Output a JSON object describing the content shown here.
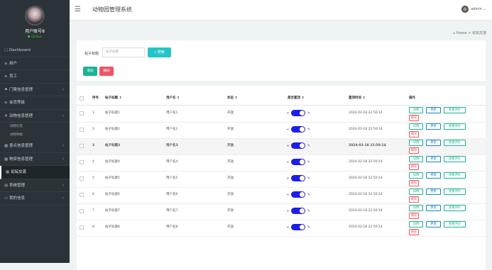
{
  "header": {
    "title": "动物园管理系统",
    "user": "admin"
  },
  "breadcrumb": {
    "home": "Home",
    "sep": ">",
    "current": "论坛交流"
  },
  "sidebar": {
    "username": "用户账号8",
    "status": "Online",
    "items": [
      {
        "label": "Dashboard",
        "icon": "monitor-icon",
        "glyph": "▢",
        "chevron": false
      },
      {
        "label": "用户",
        "icon": "user-icon",
        "glyph": "≡",
        "chevron": false
      },
      {
        "label": "员工",
        "icon": "list-icon",
        "glyph": "≡",
        "chevron": false
      },
      {
        "label": "门票信息管理",
        "icon": "flag-icon",
        "glyph": "⚑",
        "chevron": true
      },
      {
        "label": "会员等级",
        "icon": "list-icon",
        "glyph": "≡",
        "chevron": false
      },
      {
        "label": "动物信息管理",
        "icon": "gear-icon",
        "glyph": "✲",
        "chevron": true
      },
      {
        "label": "景点信息管理",
        "icon": "grid-icon",
        "glyph": "▦",
        "chevron": true
      },
      {
        "label": "物资信息管理",
        "icon": "grid-icon",
        "glyph": "▦",
        "chevron": true
      },
      {
        "label": "论坛交流",
        "icon": "grid-icon",
        "glyph": "▦",
        "chevron": false
      },
      {
        "label": "系统管理",
        "icon": "bars-icon",
        "glyph": "▤",
        "chevron": true
      },
      {
        "label": "我的信息",
        "icon": "card-icon",
        "glyph": "▭",
        "chevron": true
      }
    ],
    "subitems": [
      "动物信息",
      "动物种类"
    ]
  },
  "search": {
    "label": "帖子标题",
    "placeholder": "帖子标题",
    "button": "搜索",
    "add": "增加",
    "delete": "删除"
  },
  "table": {
    "headers": [
      "序号",
      "帖子标题 ⇕",
      "用户名 ⇕",
      "状态 ⇕",
      "是否置顶 ⇕",
      "置顶时间 ⇕",
      "操作"
    ],
    "ops": {
      "detail": "详情",
      "update": "更新",
      "comments": "查看评论",
      "delete": "删除"
    },
    "rows": [
      {
        "no": "1",
        "title": "帖子标题1",
        "user": "用户名1",
        "status": "开放",
        "time": "2024-02-18 22:50:14"
      },
      {
        "no": "2",
        "title": "帖子标题2",
        "user": "用户名2",
        "status": "开放",
        "time": "2024-02-18 22:50:14"
      },
      {
        "no": "3",
        "title": "帖子标题3",
        "user": "用户名3",
        "status": "开放",
        "time": "2024-02-18 22:50:14"
      },
      {
        "no": "4",
        "title": "帖子标题4",
        "user": "用户名4",
        "status": "开放",
        "time": "2024-02-18 22:50:14"
      },
      {
        "no": "5",
        "title": "帖子标题5",
        "user": "用户名5",
        "status": "开放",
        "time": "2024-02-18 22:50:14"
      },
      {
        "no": "6",
        "title": "帖子标题6",
        "user": "用户名6",
        "status": "开放",
        "time": "2024-02-18 22:50:14"
      },
      {
        "no": "7",
        "title": "帖子标题7",
        "user": "用户名7",
        "status": "开放",
        "time": "2024-02-18 22:50:14"
      },
      {
        "no": "8",
        "title": "帖子标题8",
        "user": "用户名8",
        "status": "开放",
        "time": "2024-02-18 22:50:14"
      }
    ]
  }
}
